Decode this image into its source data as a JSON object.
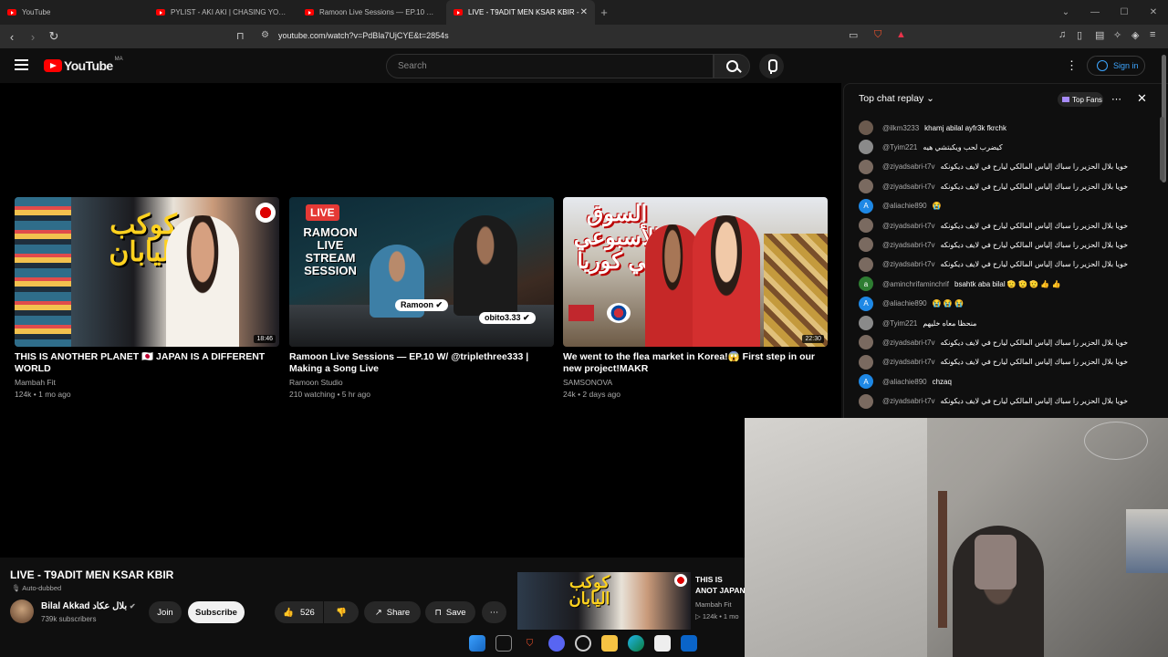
{
  "browser": {
    "tabs": [
      {
        "label": "YouTube",
        "active": false
      },
      {
        "label": "PYLIST - AKI AKI | CHASING YOUR C",
        "active": false
      },
      {
        "label": "Ramoon Live Sessions — EP.10 W/ @",
        "active": false
      },
      {
        "label": "LIVE - T9ADIT MEN KSAR KBIR -",
        "active": true
      }
    ],
    "new_tab": "+",
    "url": "youtube.com/watch?v=PdBla7UjCYE&t=2854s"
  },
  "youtube": {
    "logo_text": "YouTube",
    "region": "MA",
    "search_placeholder": "Search",
    "signin_label": "Sign in",
    "more": "⋮"
  },
  "end_cards": [
    {
      "thumb_text": "كوكب اليابان",
      "duration": "18:46",
      "title": "THIS IS ANOTHER PLANET 🇯🇵 JAPAN IS A DIFFERENT WORLD",
      "channel": "Mambah Fit",
      "meta": "124k • 1 mo ago"
    },
    {
      "thumb_text": "RAMOON LIVE STREAM SESSION",
      "duration": "",
      "title": "Ramoon Live Sessions — EP.10 W/ @triplethree333 | Making a Song Live",
      "channel": "Ramoon Studio",
      "meta": "210 watching • 5 hr ago"
    },
    {
      "thumb_text": "السوق الأسبوعي في كوريا",
      "duration": "22:30",
      "title": "We went to the flea market in Korea!😱 First step in our new project!MAKR",
      "channel": "SAMSONOVA",
      "meta": "24k • 2 days ago"
    }
  ],
  "video": {
    "title": "LIVE - T9ADIT MEN KSAR KBIR",
    "auto_dubbed": "Auto-dubbed",
    "channel": "Bilal Akkad بلال عكاد",
    "subscribers": "739k subscribers",
    "join": "Join",
    "subscribe": "Subscribe",
    "likes": "526",
    "share": "Share",
    "save": "Save"
  },
  "mini_card": {
    "title": "THIS IS ANOT JAPAN IS A D",
    "channel": "Mambah Fit",
    "meta": "124k • 1 mo"
  },
  "chat": {
    "header": "Top chat replay",
    "top_fans": "Top Fans",
    "messages": [
      {
        "author": "@ilkm3233",
        "text": "khamj abilal ayfr3k fkrchk",
        "avatar_color": "#6b5a4e",
        "initial": ""
      },
      {
        "author": "@Tyim221",
        "text": "كيضرب لحب ويكبتشي هيه",
        "avatar_color": "#8a8a8a",
        "initial": ""
      },
      {
        "author": "@ziyadsabri-t7v",
        "text": "خويا بلال الحزير را سباك إلياس المالكي ليارح في لايف ديكونكه",
        "avatar_color": "#7a6a60",
        "initial": ""
      },
      {
        "author": "@ziyadsabri-t7v",
        "text": "خويا بلال الحزير را سباك إلياس المالكي ليارح في لايف ديكونكه",
        "avatar_color": "#7a6a60",
        "initial": ""
      },
      {
        "author": "@aliachie890",
        "text": "😭",
        "avatar_color": "#1e88e5",
        "initial": "A"
      },
      {
        "author": "@ziyadsabri-t7v",
        "text": "خويا بلال الحزير را سباك إلياس المالكي ليارح في لايف ديكونكه",
        "avatar_color": "#7a6a60",
        "initial": ""
      },
      {
        "author": "@ziyadsabri-t7v",
        "text": "خويا بلال الحزير را سباك إلياس المالكي ليارح في لايف ديكونكه",
        "avatar_color": "#7a6a60",
        "initial": ""
      },
      {
        "author": "@ziyadsabri-t7v",
        "text": "خويا بلال الحزير را سباك إلياس المالكي ليارح في لايف ديكونكه",
        "avatar_color": "#7a6a60",
        "initial": ""
      },
      {
        "author": "@aminchrifaminchrif",
        "text": "bsahtk aba bilal 🫡 🫡 🫡 👍 👍",
        "avatar_color": "#2e7d32",
        "initial": "a"
      },
      {
        "author": "@aliachie890",
        "text": "😭 😭 😭",
        "avatar_color": "#1e88e5",
        "initial": "A"
      },
      {
        "author": "@Tyim221",
        "text": "منحظا معاه خليهم",
        "avatar_color": "#8a8a8a",
        "initial": ""
      },
      {
        "author": "@ziyadsabri-t7v",
        "text": "خويا بلال الحزير را سباك إلياس المالكي ليارح في لايف ديكونكه",
        "avatar_color": "#7a6a60",
        "initial": ""
      },
      {
        "author": "@ziyadsabri-t7v",
        "text": "خويا بلال الحزير را سباك إلياس المالكي ليارح في لايف ديكونكه",
        "avatar_color": "#7a6a60",
        "initial": ""
      },
      {
        "author": "@aliachie890",
        "text": "chzaq",
        "avatar_color": "#1e88e5",
        "initial": "A"
      },
      {
        "author": "@ziyadsabri-t7v",
        "text": "خويا بلال الحزير را سباك إلياس المالكي ليارح في لايف ديكونكه",
        "avatar_color": "#7a6a60",
        "initial": ""
      }
    ]
  },
  "taskbar": {
    "icons": [
      "windows-icon",
      "task-view-icon",
      "brave-icon",
      "discord-icon",
      "obs-icon",
      "file-explorer-icon",
      "edge-icon",
      "store-icon",
      "mail-icon"
    ]
  }
}
